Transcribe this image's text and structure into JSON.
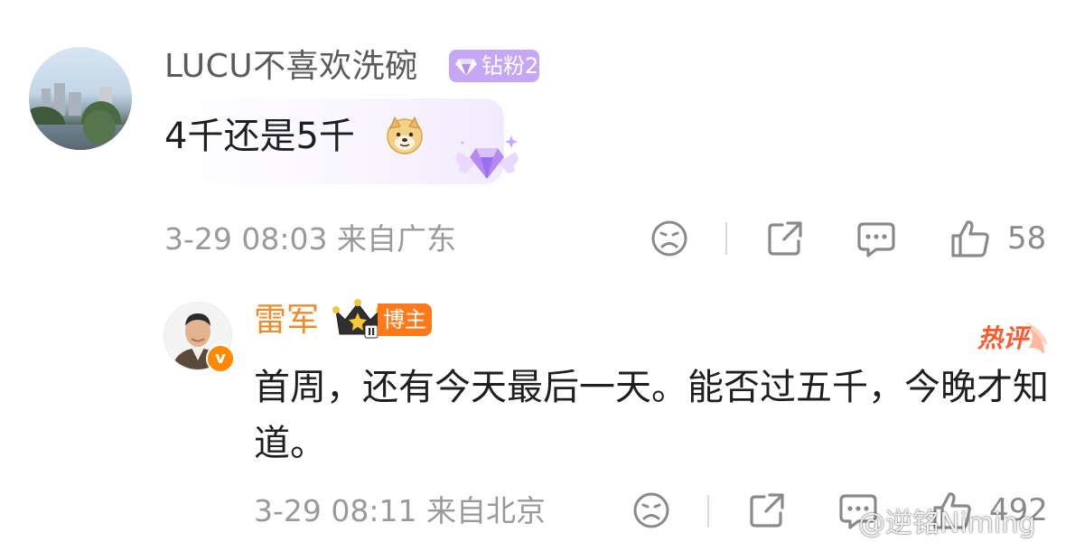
{
  "comment": {
    "user_name": "LUCU不喜欢洗碗",
    "fan_badge": "钻粉2",
    "text": "4千还是5千",
    "meta": "3-29 08:03 来自广东",
    "like_count": "58",
    "icons": [
      "sad-face-icon",
      "share-icon",
      "comment-icon",
      "like-icon"
    ]
  },
  "reply": {
    "user_name": "雷军",
    "verified_mark": "v",
    "host_badge": "博主",
    "hot_tag": "热评",
    "text": "首周，还有今天最后一天。能否过五千，今晚才知道。",
    "meta": "3-29 08:11 来自北京",
    "like_count": "492",
    "icons": [
      "sad-face-icon",
      "share-icon",
      "comment-icon",
      "like-icon"
    ]
  },
  "watermark": "@逆铭Niming",
  "colors": {
    "host_name": "#f28a25",
    "host_badge": "#ff7a1a",
    "fan_badge": "#c6a6f7",
    "meta_text": "#9a9a9a"
  }
}
